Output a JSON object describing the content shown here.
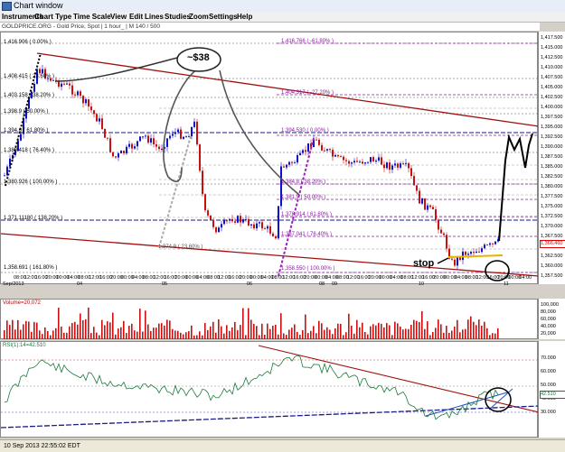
{
  "window": {
    "title": "Chart window"
  },
  "menu": [
    "Instruments",
    "Chart Type",
    "Time Scale",
    "View",
    "Edit",
    "Lines",
    "Studies",
    "Zoom",
    "Settings",
    "Help"
  ],
  "info": "GOLDPRICE.ORG - Gold Price, Spot | 1 hour_ | M 140 / 500",
  "price_labels": {
    "top_left": "1,416.906 ( 0.00% )",
    "l1": "1,408.415 ( 23.60% )",
    "l2": "1,403.158 ( 38.20% )",
    "l3": "1,398.9 ( 50.00% )",
    "l4": "1,394.6 ( 61.80% )",
    "l5": "1,389.418 ( 76.40% )",
    "l6": "1,380.926 ( 100.00% )",
    "l7": "1,371.11180 ( 138.20% )",
    "l8": "1,358.691 ( 161.80% )",
    "mid1": "1,416.766 ( -61.80% )",
    "mid2": "1,404.317 ( -27.20% )",
    "mid3": "1,394.530 ( 0.00% )",
    "mid4": "1,367.041 ( 76.40% )",
    "mid5": "1,358.550 ( 100.00% )",
    "mid6": "1,378.914 ( 61.80% )",
    "mid7": "1,381.9 ( 50.00% )",
    "mid8": "1,384.8 ( 38.20% )",
    "mid9": "1,374.9 ( 23.60% )"
  },
  "annotations": {
    "bubble": "~$38",
    "stop": "stop"
  },
  "price_axis": [
    "1,417.500",
    "1,415.000",
    "1,412.500",
    "1,410.000",
    "1,407.500",
    "1,405.000",
    "1,402.500",
    "1,400.000",
    "1,397.500",
    "1,395.000",
    "1,392.500",
    "1,390.000",
    "1,387.500",
    "1,385.000",
    "1,382.500",
    "1,380.000",
    "1,377.500",
    "1,375.000",
    "1,372.500",
    "1,370.000",
    "1,367.500",
    "1,365.000",
    "1,362.500",
    "1,360.000",
    "1,357.500"
  ],
  "last_price": "1,366.460",
  "time_axis": {
    "hours": [
      "08:00",
      "12:00",
      "16:00",
      "20:00",
      "00:00",
      "04:00",
      "08:00",
      "12:00",
      "16:00",
      "20:00",
      "00:00",
      "04:00",
      "08:00",
      "12:00",
      "16:00",
      "20:00",
      "00:00",
      "04:00",
      "08:00",
      "12:00",
      "16:00",
      "20:00",
      "00:00",
      "04:00",
      "08:00",
      "12:00",
      "16:00",
      "20:00",
      "00:00",
      "04:00",
      "08:00",
      "12:00",
      "16:00",
      "20:00",
      "00:00",
      "04:00",
      "08:00",
      "12:00",
      "16:00",
      "20:00",
      "00:00",
      "04:00",
      "08:00",
      "12:00",
      "16:00",
      "20:00",
      "00:00",
      "04:00"
    ],
    "days": [
      "Sep/2013",
      "04",
      "05",
      "06",
      "08",
      "09",
      "10",
      "11"
    ]
  },
  "volume": {
    "label": "Volume=20,072",
    "axis": [
      "100,000",
      "80,000",
      "60,000",
      "40,000",
      "20,000"
    ],
    "last": "20,072"
  },
  "rsi": {
    "label": "RSI(1):14=42.510",
    "axis": [
      "70.000",
      "60.000",
      "50.000",
      "40.000",
      "30.000"
    ],
    "last": "42.510"
  },
  "status": "10 Sep 2013 22:55:02 EDT",
  "colors": {
    "bull": "#1010c8",
    "bear": "#c81010",
    "trend": "#a01010",
    "fib_purple": "#8a1aa0",
    "rsi_line": "#1a7a3a"
  }
}
